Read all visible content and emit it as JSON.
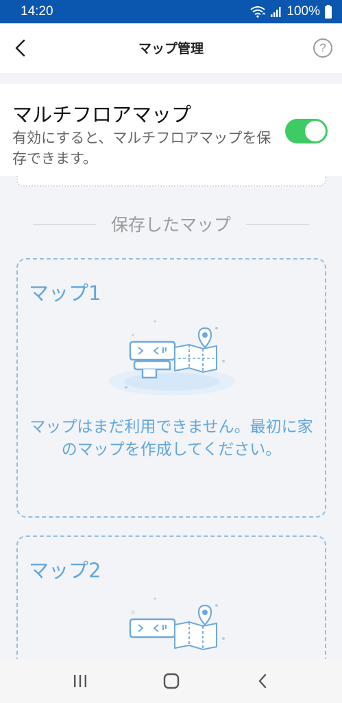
{
  "status_bar": {
    "time": "14:20",
    "battery": "100%",
    "icons": [
      "wifi-icon",
      "signal-icon",
      "battery-icon"
    ]
  },
  "header": {
    "title": "マップ管理",
    "back_icon": "chevron-left-icon",
    "help_icon": "help-circle-icon",
    "help_glyph": "?"
  },
  "multi_floor": {
    "title": "マルチフロアマップ",
    "description": "有効にすると、マルチフロアマップを保存できます。",
    "toggle_on": true,
    "toggle_color": "#3ecb63"
  },
  "saved_maps": {
    "section_label": "保存したマップ",
    "maps": [
      {
        "name": "マップ1",
        "empty_message": "マップはまだ利用できません。最初に家のマップを作成してください。"
      },
      {
        "name": "マップ2"
      }
    ]
  },
  "nav_bar": {
    "icons": [
      "recent-apps-icon",
      "home-icon",
      "back-icon"
    ]
  },
  "colors": {
    "status_bar": "#0b57b0",
    "accent_blue": "#63a6dc",
    "background": "#f2f4f8"
  }
}
